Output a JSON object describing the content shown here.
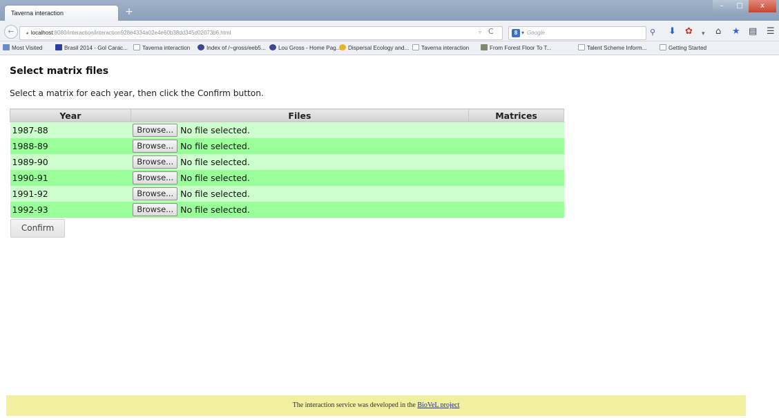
{
  "browser": {
    "tab_title": "Taverna interaction",
    "new_tab_glyph": "+",
    "window_controls": {
      "minimize": "–",
      "maximize": "□",
      "close": "x"
    },
    "url_host": "localhost",
    "url_rest": ":8080/interaction/interaction928e4334a02e4e60b38dd345d02073b6.html",
    "search_placeholder": "Google",
    "search_engine_letter": "8",
    "bookmarks": [
      "Most Visited",
      "Brasil 2014 - Gol Carac...",
      "Taverna interaction",
      "Index of /~gross/eeb5...",
      "Lou Gross - Home Pag...",
      "Dispersal Ecology and...",
      "Taverna interaction",
      "From Forest Floor To T...",
      "Talent Scheme Inform...",
      "Getting Started"
    ],
    "icons": [
      "globe-icon",
      "reload-icon",
      "search-icon",
      "download-icon",
      "addon-icon",
      "home-icon",
      "bookmark-star-icon",
      "library-icon",
      "menu-icon"
    ]
  },
  "page": {
    "heading": "Select matrix files",
    "instructions": "Select a matrix for each year, then click the Confirm button.",
    "columns": [
      "Year",
      "Files",
      "Matrices"
    ],
    "rows": [
      {
        "year": "1987-88",
        "browse_label": "Browse...",
        "file_status": "No file selected.",
        "matrix": ""
      },
      {
        "year": "1988-89",
        "browse_label": "Browse...",
        "file_status": "No file selected.",
        "matrix": ""
      },
      {
        "year": "1989-90",
        "browse_label": "Browse...",
        "file_status": "No file selected.",
        "matrix": ""
      },
      {
        "year": "1990-91",
        "browse_label": "Browse...",
        "file_status": "No file selected.",
        "matrix": ""
      },
      {
        "year": "1991-92",
        "browse_label": "Browse...",
        "file_status": "No file selected.",
        "matrix": ""
      },
      {
        "year": "1992-93",
        "browse_label": "Browse...",
        "file_status": "No file selected.",
        "matrix": ""
      }
    ],
    "confirm_label": "Confirm",
    "row_colors": {
      "light": "#ccffcc",
      "dark": "#99ff99"
    }
  },
  "footer": {
    "text": "The interaction service was developed in the",
    "link_text": "BioVeL project",
    "background": "#f0f0a0"
  }
}
